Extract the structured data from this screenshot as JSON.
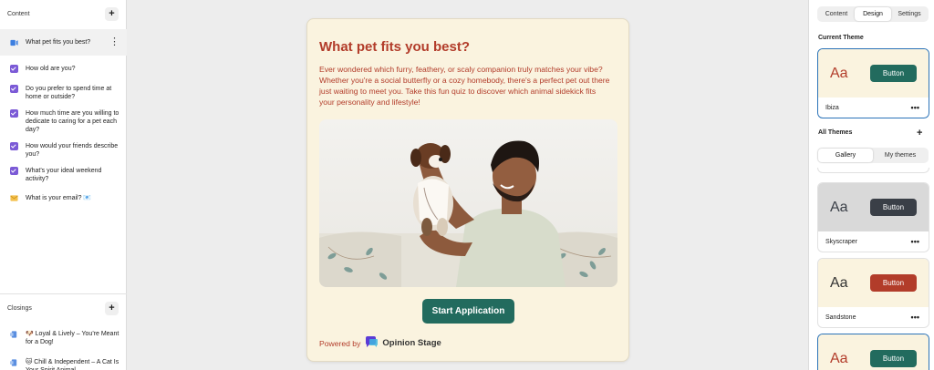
{
  "content_panel": {
    "header": "Content",
    "add_symbol": "+",
    "questions": [
      {
        "label": "What pet fits you best?",
        "icon": "intro-icon",
        "active": true
      },
      {
        "label": "How old are you?",
        "icon": "checkbox-icon"
      },
      {
        "label": "Do you prefer to spend time at home or outside?",
        "icon": "checkbox-icon"
      },
      {
        "label": "How much time are you willing to dedicate to caring for a pet each day?",
        "icon": "checkbox-icon"
      },
      {
        "label": "How would your friends describe you?",
        "icon": "checkbox-icon"
      },
      {
        "label": "What's your ideal weekend activity?",
        "icon": "checkbox-icon"
      },
      {
        "label": "What is your email? 📧",
        "icon": "email-icon"
      }
    ],
    "more_symbol": "⋮"
  },
  "closings_panel": {
    "header": "Closings",
    "add_symbol": "+",
    "items": [
      {
        "label": "🐶 Loyal & Lively – You're Meant for a Dog!"
      },
      {
        "label": "🐱 Chill & Independent – A Cat Is Your Spirit Animal"
      }
    ]
  },
  "preview": {
    "title": "What pet fits you best?",
    "description": "Ever wondered which furry, feathery, or scaly companion truly matches your vibe? Whether you're a social butterfly or a cozy homebody, there's a perfect pet out there just waiting to meet you. Take this fun quiz to discover which animal sidekick fits your personality and lifestyle!",
    "button_label": "Start Application",
    "powered_by": "Powered by",
    "brand": "Opinion Stage"
  },
  "design_panel": {
    "tabs": [
      "Content",
      "Design",
      "Settings"
    ],
    "selected_tab": "Design",
    "current_theme_label": "Current Theme",
    "all_themes_label": "All Themes",
    "add_symbol": "+",
    "segments": [
      "Gallery",
      "My themes"
    ],
    "selected_segment": "Gallery",
    "sample_text": "Aa",
    "sample_button": "Button",
    "more_symbol": "•••",
    "current_theme": {
      "name": "Ibiza",
      "bg": "#faf3df",
      "aa_color": "#b23c2a",
      "button_color": "#226b5e"
    },
    "themes": [
      {
        "name": "Skyscraper",
        "bg": "#d9d9d9",
        "aa_color": "#3a3f47",
        "button_color": "#3a3f47"
      },
      {
        "name": "Sandstone",
        "bg": "#faf3df",
        "aa_color": "#333333",
        "button_color": "#b23c2a"
      },
      {
        "name": "",
        "bg": "#faf3df",
        "aa_color": "#b23c2a",
        "button_color": "#226b5e"
      }
    ]
  },
  "colors": {
    "accent_red": "#b23c2a",
    "accent_green": "#226b5e",
    "check_purple": "#7b5ad6",
    "selected_blue": "#2b73b8"
  }
}
